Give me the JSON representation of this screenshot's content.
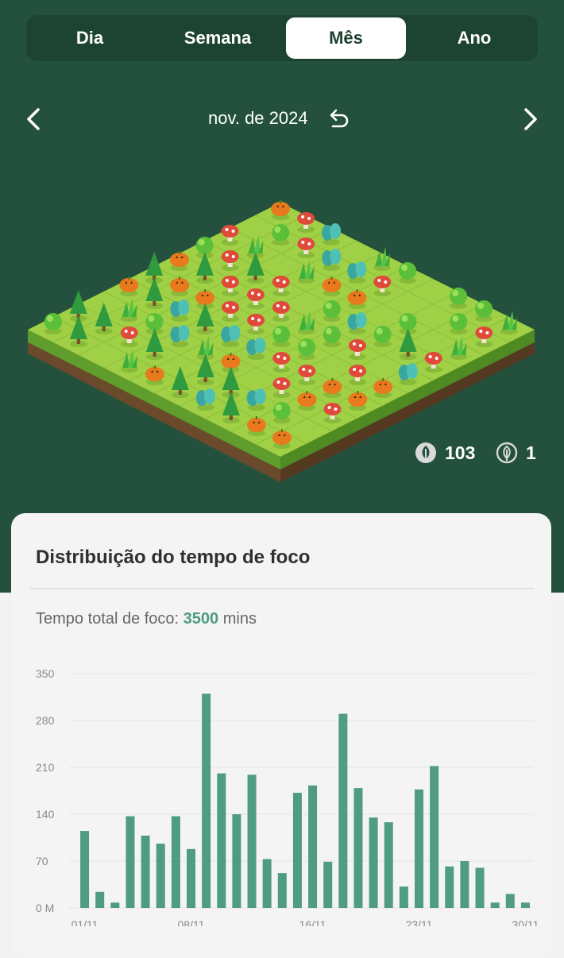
{
  "tabs": [
    {
      "label": "Dia",
      "active": false
    },
    {
      "label": "Semana",
      "active": false
    },
    {
      "label": "Mês",
      "active": true
    },
    {
      "label": "Ano",
      "active": false
    }
  ],
  "period": {
    "label": "nov. de 2024",
    "prev_icon": "chevron-left-icon",
    "next_icon": "chevron-right-icon",
    "reset_icon": "undo-icon"
  },
  "stats": {
    "healthy_trees": "103",
    "dead_trees": "1"
  },
  "card": {
    "title": "Distribuição do tempo de foco",
    "total_prefix": "Tempo total de foco: ",
    "total_value": "3500",
    "total_unit": " mins"
  },
  "colors": {
    "background": "#23513d",
    "bar": "#4f9c80",
    "accent": "#4f9c80"
  },
  "chart_data": {
    "type": "bar",
    "categories": [
      "01/11",
      "02/11",
      "03/11",
      "04/11",
      "05/11",
      "06/11",
      "07/11",
      "08/11",
      "09/11",
      "10/11",
      "11/11",
      "12/11",
      "13/11",
      "14/11",
      "15/11",
      "16/11",
      "17/11",
      "18/11",
      "19/11",
      "20/11",
      "21/11",
      "22/11",
      "23/11",
      "24/11",
      "25/11",
      "26/11",
      "27/11",
      "28/11",
      "29/11",
      "30/11"
    ],
    "values": [
      115,
      24,
      8,
      137,
      108,
      96,
      137,
      88,
      320,
      201,
      140,
      199,
      73,
      52,
      172,
      183,
      69,
      290,
      179,
      135,
      128,
      32,
      177,
      212,
      62,
      70,
      60,
      8,
      21,
      8
    ],
    "ylim": [
      0,
      350
    ],
    "yticks": [
      "0 M",
      "70",
      "140",
      "210",
      "280",
      "350"
    ],
    "xtick_labels": [
      "01/11",
      "08/11",
      "16/11",
      "23/11",
      "30/11"
    ],
    "xtick_indices": [
      0,
      7,
      15,
      22,
      29
    ],
    "grid": true,
    "title": "",
    "xlabel": "",
    "ylabel": ""
  }
}
